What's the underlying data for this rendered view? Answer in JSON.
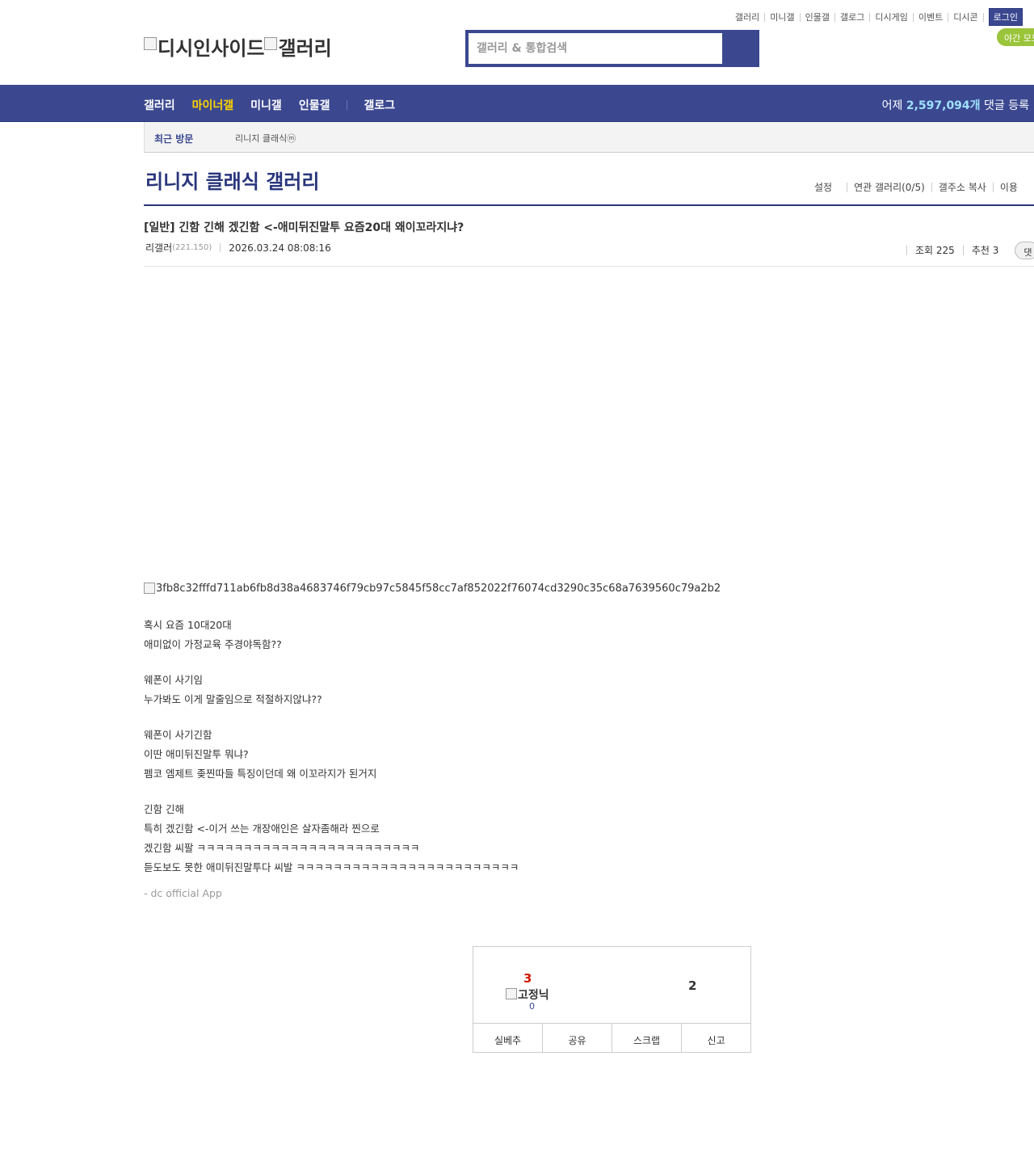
{
  "util_links": [
    "갤러리",
    "미니갤",
    "인물갤",
    "갤로그",
    "디시게임",
    "이벤트",
    "디시콘"
  ],
  "login_label": "로그인",
  "night_mode_label": "야간 모드",
  "logo": {
    "brand": "디시인사이드",
    "section": "갤러리"
  },
  "search": {
    "placeholder": "갤러리 & 통합검색"
  },
  "gnb": {
    "items": [
      "갤러리",
      "마이너갤",
      "미니갤",
      "인물갤"
    ],
    "gallog": "갤로그",
    "count_prefix": "어제",
    "count_value": "2,597,094개",
    "count_suffix": "댓글 등록"
  },
  "recent": {
    "title": "최근 방문",
    "item": "리니지 클래식ⓜ"
  },
  "gallery": {
    "title": "리니지 클래식 갤러리",
    "options": [
      "설정",
      "연관 갤러리(0/5)",
      "갤주소 복사",
      "이용"
    ]
  },
  "post": {
    "title": "[일반] 긴함 긴해 겠긴함 <-애미뒤진말투 요즘20대 왜이꼬라지냐?",
    "author": "리갤러",
    "ip": "(221.150)",
    "date": "2026.03.24 08:08:16",
    "views": "조회 225",
    "recommends": "추천 3",
    "comment_btn": "댓"
  },
  "image_alt": "3fb8c32fffd711ab6fb8d38a4683746f79cb97c5845f58cc7af852022f76074cd3290c35c68a7639560c79a2b2",
  "content": {
    "p1_l1": "혹시 요즘 10대20대",
    "p1_l2": "애미없이 가정교육 주경야독함??",
    "p2_l1": "웨폰이 사기임",
    "p2_l2": "누가봐도 이게 말줄임으로 적절하지않냐??",
    "p3_l1": "웨폰이 사기긴함",
    "p3_l2": "이딴 애미뒤진말투 뭐냐?",
    "p3_l3": "펨코 엠제트 좆찐따들 특징이던데 왜 이꼬라지가 된거지",
    "p4_l1": "긴함 긴해",
    "p4_l2": "특히 겠긴함 <-이거 쓰는 개장애인은 살자좀해라 찐으로",
    "p4_l3": "겠긴함 씨팔 ㅋㅋㅋㅋㅋㅋㅋㅋㅋㅋㅋㅋㅋㅋㅋㅋㅋㅋㅋㅋㅋㅋㅋㅋ",
    "p4_l4": "듣도보도 못한 애미뒤진말투다 씨발 ㅋㅋㅋㅋㅋㅋㅋㅋㅋㅋㅋㅋㅋㅋㅋㅋㅋㅋㅋㅋㅋㅋㅋㅋ"
  },
  "app_sig": "- dc official App",
  "recommend": {
    "up_count": "3",
    "fixed_label": "고정닉",
    "fixed_count": "0",
    "down_count": "2",
    "buttons": [
      "실베추",
      "공유",
      "스크랩",
      "신고"
    ]
  }
}
